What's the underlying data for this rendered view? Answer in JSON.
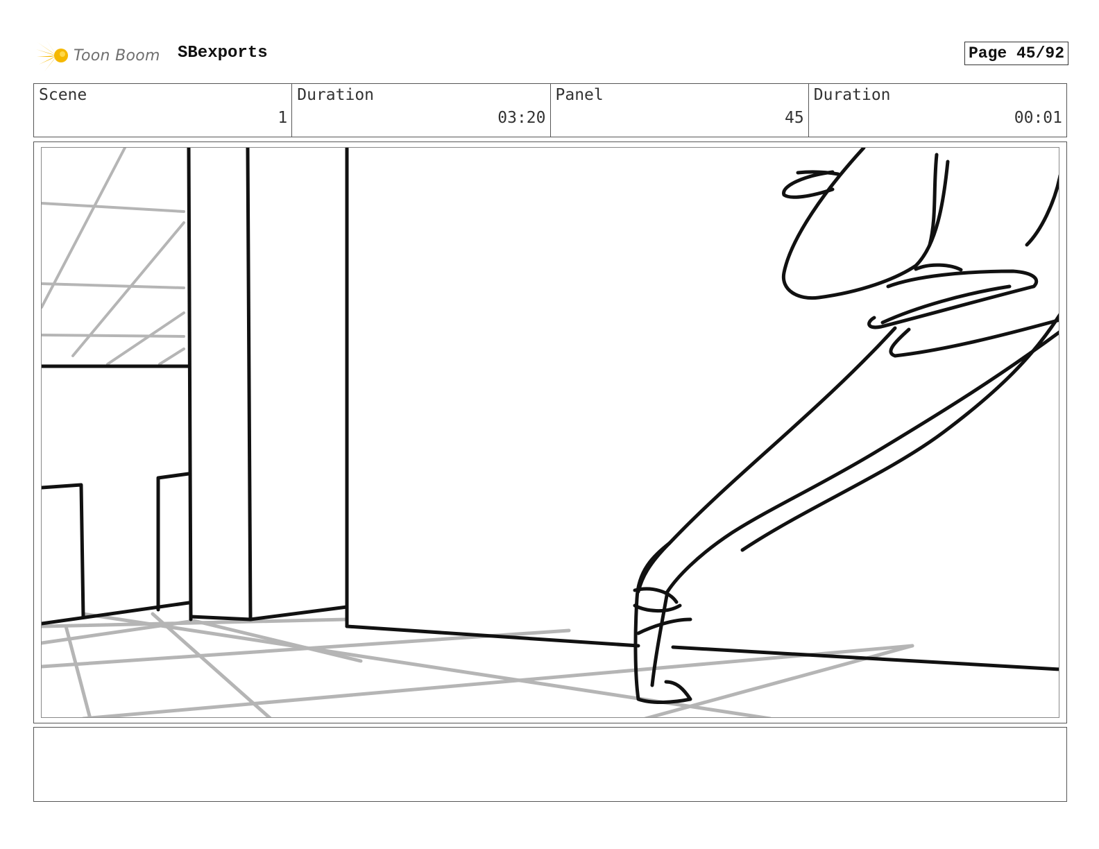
{
  "header": {
    "logo_text": "Toon Boom",
    "project": "SBexports",
    "page": "Page 45/92"
  },
  "info": {
    "scene_label": "Scene",
    "scene_value": "1",
    "scene_duration_label": "Duration",
    "scene_duration_value": "03:20",
    "panel_label": "Panel",
    "panel_value": "45",
    "panel_duration_label": "Duration",
    "panel_duration_value": "00:01"
  },
  "colors": {
    "logo_yellow": "#f5b800",
    "sketch_black": "#111111",
    "sketch_grey": "#b5b5b5"
  },
  "notes": {
    "text": ""
  }
}
